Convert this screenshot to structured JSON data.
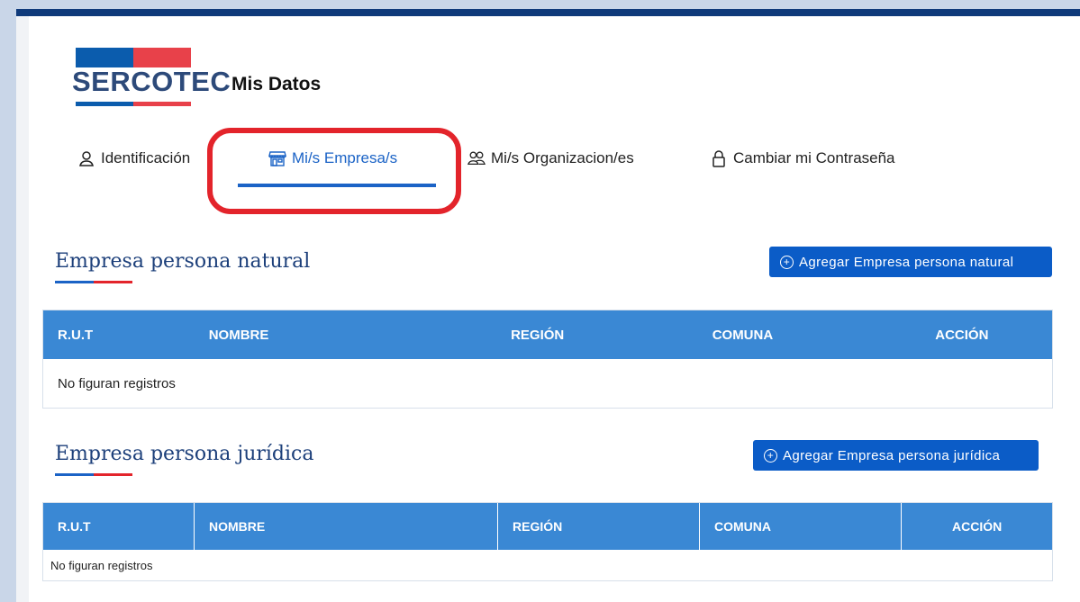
{
  "header": {
    "logo_text": "SERCOTEC",
    "page_title": "Mis Datos"
  },
  "tabs": [
    {
      "label": "Identificación",
      "icon": "user-icon"
    },
    {
      "label": "Mi/s Empresa/s",
      "icon": "store-icon",
      "active": true
    },
    {
      "label": "Mi/s Organizacion/es",
      "icon": "users-icon"
    },
    {
      "label": "Cambiar mi Contraseña",
      "icon": "lock-icon"
    }
  ],
  "colors": {
    "brand_blue": "#0b5cad",
    "brand_red": "#e8414a",
    "active_tab": "#1b63c6",
    "table_header": "#3a88d4",
    "highlight": "#e3242b"
  },
  "natural": {
    "title": "Empresa persona natural",
    "add_label": "Agregar Empresa persona natural",
    "columns": [
      "R.U.T",
      "NOMBRE",
      "REGIÓN",
      "COMUNA",
      "ACCIÓN"
    ],
    "empty": "No figuran registros"
  },
  "juridica": {
    "title": "Empresa persona jurídica",
    "add_label": "Agregar Empresa persona jurídica",
    "columns": [
      "R.U.T",
      "NOMBRE",
      "REGIÓN",
      "COMUNA",
      "ACCIÓN"
    ],
    "empty": "No figuran registros"
  }
}
